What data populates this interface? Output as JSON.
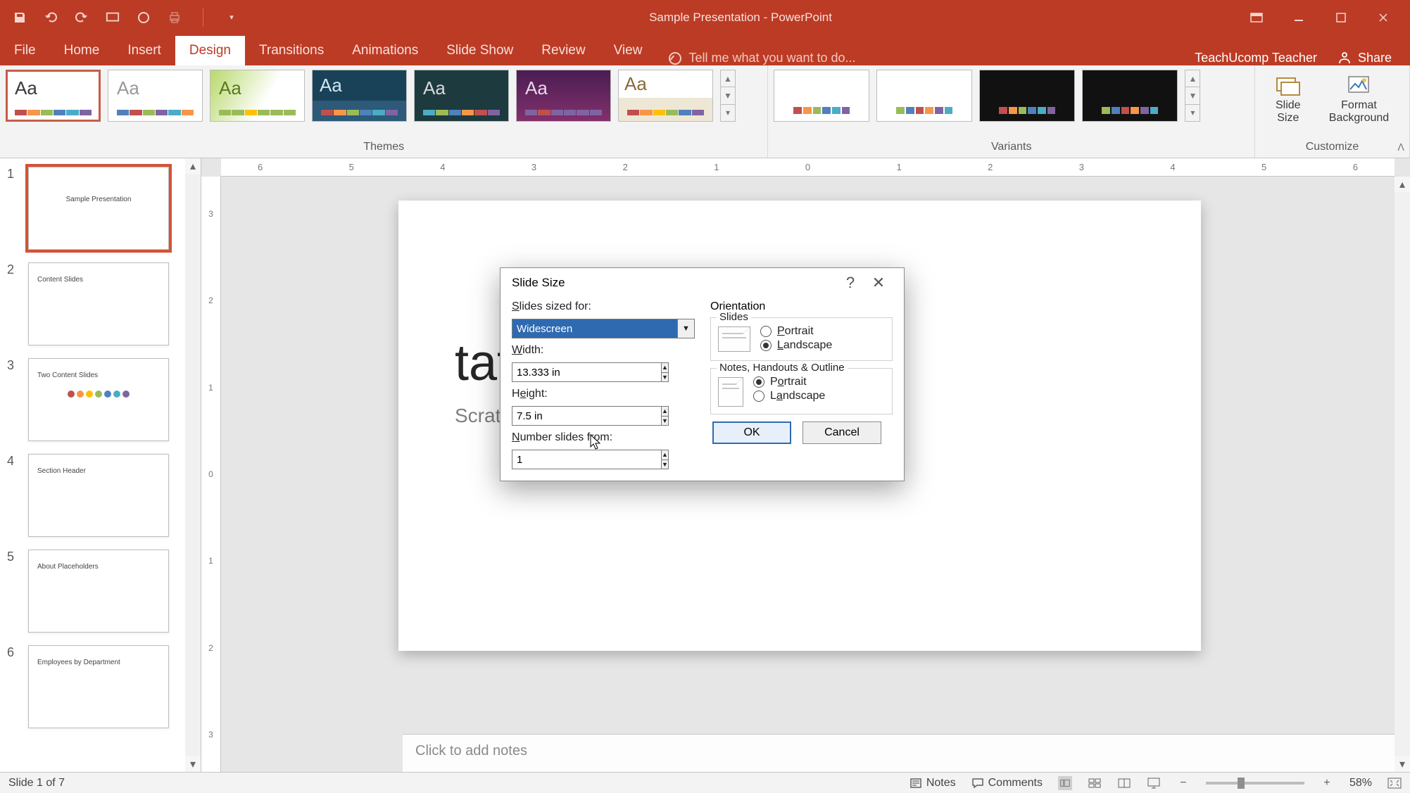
{
  "title": "Sample Presentation - PowerPoint",
  "user": "TeachUcomp Teacher",
  "share": "Share",
  "tabs": [
    "File",
    "Home",
    "Insert",
    "Design",
    "Transitions",
    "Animations",
    "Slide Show",
    "Review",
    "View"
  ],
  "active_tab": 3,
  "tellme": "Tell me what you want to do...",
  "ribbon": {
    "themes_label": "Themes",
    "variants_label": "Variants",
    "customize_label": "Customize",
    "slide_size": "Slide\nSize",
    "format_bg": "Format\nBackground"
  },
  "thumbs": [
    {
      "n": "1",
      "lines": [
        "Sample Presentation",
        ""
      ]
    },
    {
      "n": "2",
      "lines": [
        "Content Slides",
        ""
      ]
    },
    {
      "n": "3",
      "lines": [
        "Two Content Slides",
        ""
      ]
    },
    {
      "n": "4",
      "lines": [
        "Section Header",
        ""
      ]
    },
    {
      "n": "5",
      "lines": [
        "About Placeholders",
        ""
      ]
    },
    {
      "n": "6",
      "lines": [
        "Employees by Department",
        ""
      ]
    }
  ],
  "ruler_h": [
    "6",
    "5",
    "4",
    "3",
    "2",
    "1",
    "0",
    "1",
    "2",
    "3",
    "4",
    "5",
    "6"
  ],
  "ruler_v": [
    "3",
    "2",
    "1",
    "0",
    "1",
    "2",
    "3"
  ],
  "slide": {
    "title": "tation",
    "subtitle": "Scratch"
  },
  "notes_placeholder": "Click to add notes",
  "statusbar": {
    "slide_count": "Slide 1 of 7",
    "notes": "Notes",
    "comments": "Comments",
    "zoom": "58%"
  },
  "dialog": {
    "title": "Slide Size",
    "sized_for_label": "Slides sized for:",
    "sized_for_value": "Widescreen",
    "width_label": "Width:",
    "width_value": "13.333 in",
    "height_label": "Height:",
    "height_value": "7.5 in",
    "number_label": "Number slides from:",
    "number_value": "1",
    "orientation_label": "Orientation",
    "slides_fs": "Slides",
    "notes_fs": "Notes, Handouts & Outline",
    "portrait": "Portrait",
    "landscape": "Landscape",
    "ok": "OK",
    "cancel": "Cancel"
  }
}
